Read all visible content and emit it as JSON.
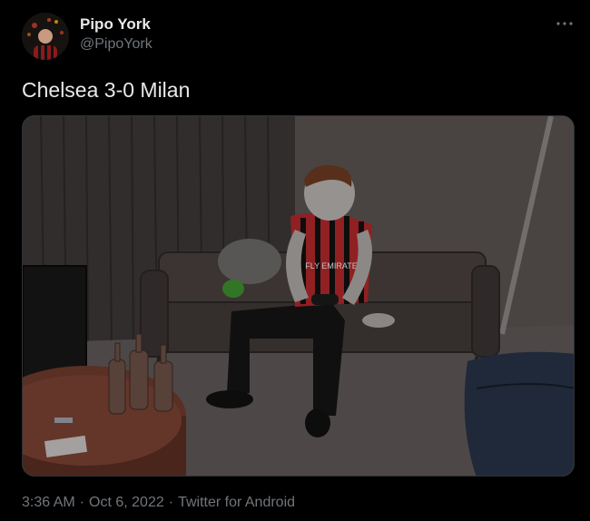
{
  "author": {
    "display_name": "Pipo York",
    "handle": "@PipoYork"
  },
  "tweet": {
    "text": "Chelsea 3-0 Milan"
  },
  "media": {
    "jersey_text": "FLY EMIRATES"
  },
  "meta": {
    "time": "3:36 AM",
    "separator": "·",
    "date": "Oct 6, 2022",
    "source": "Twitter for Android"
  },
  "icons": {
    "more": "more-icon"
  },
  "colors": {
    "background": "#000000",
    "text": "#e7e9ea",
    "muted": "#71767b",
    "border": "#2f3336"
  }
}
